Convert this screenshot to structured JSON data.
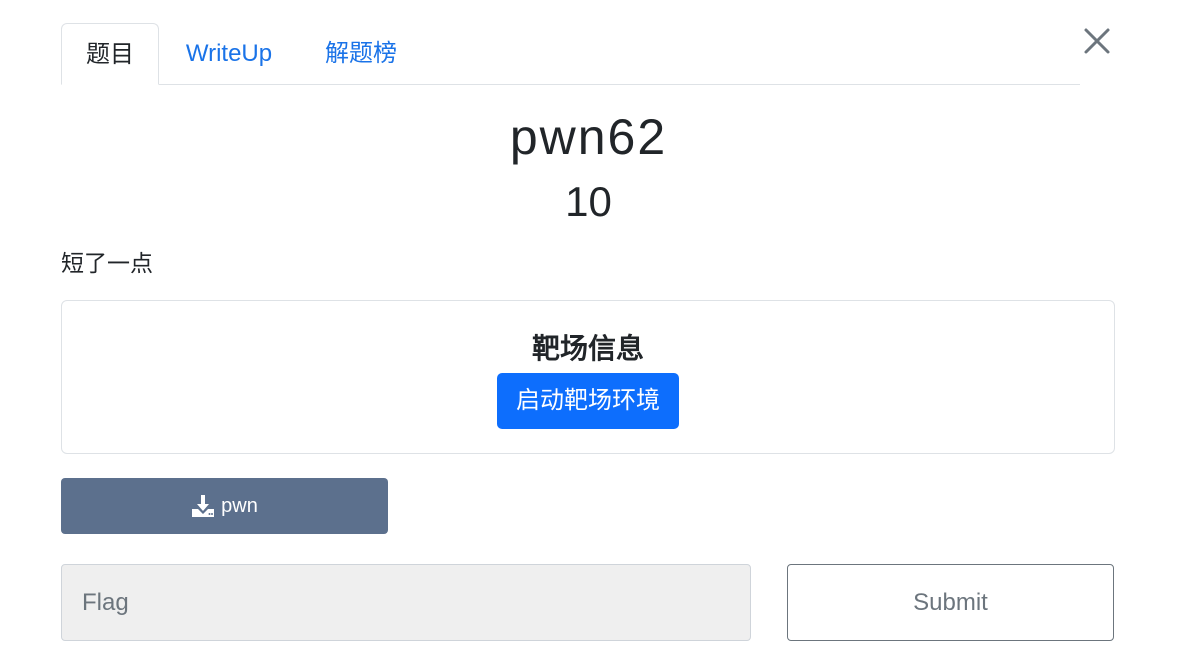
{
  "tabs": [
    {
      "label": "题目",
      "active": true
    },
    {
      "label": "WriteUp",
      "active": false
    },
    {
      "label": "解题榜",
      "active": false
    }
  ],
  "challenge": {
    "name": "pwn62",
    "score": "10",
    "description": "短了一点"
  },
  "environment": {
    "title": "靶场信息",
    "start_label": "启动靶场环境"
  },
  "download": {
    "label": "pwn",
    "icon": "download-icon"
  },
  "flag": {
    "placeholder": "Flag",
    "value": ""
  },
  "submit_label": "Submit",
  "colors": {
    "link": "#1a73e8",
    "primary": "#0d6efd",
    "download": "#5c708d"
  }
}
